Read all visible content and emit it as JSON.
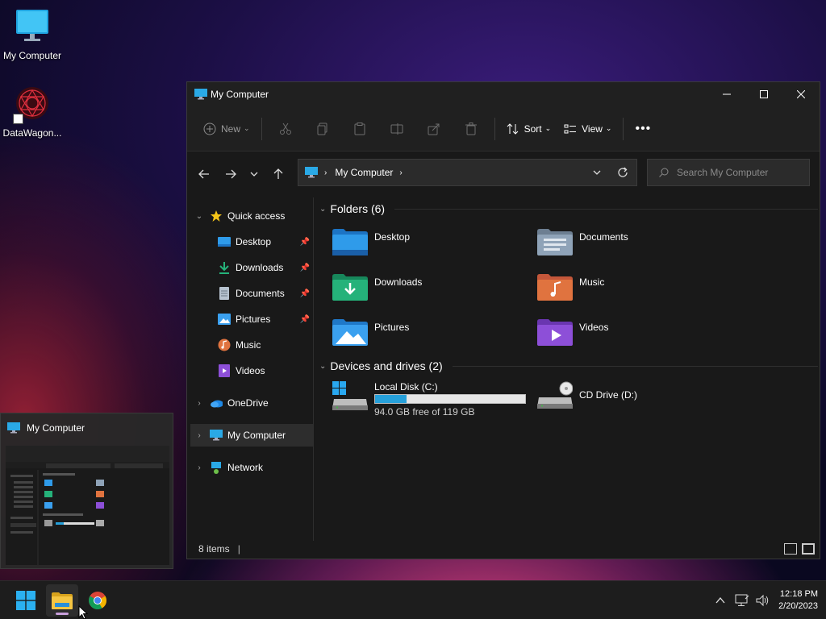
{
  "desktop": {
    "icons": [
      {
        "label": "My Computer",
        "icon": "monitor-icon"
      },
      {
        "label": "DataWagon...",
        "icon": "datawagon-logo-icon"
      }
    ]
  },
  "window": {
    "title": "My Computer",
    "controls": {
      "minimize": "minimize-icon",
      "maximize": "maximize-icon",
      "close": "close-icon"
    },
    "toolbar": {
      "new_label": "New",
      "sort_label": "Sort",
      "view_label": "View",
      "icons": [
        "cut-icon",
        "copy-icon",
        "paste-icon",
        "rename-icon",
        "share-icon",
        "delete-icon",
        "more-icon"
      ]
    },
    "address": {
      "segments": [
        "My Computer"
      ],
      "search_placeholder": "Search My Computer"
    },
    "nav": {
      "quick_access": "Quick access",
      "items": [
        {
          "label": "Desktop",
          "pinned": true
        },
        {
          "label": "Downloads",
          "pinned": true
        },
        {
          "label": "Documents",
          "pinned": true
        },
        {
          "label": "Pictures",
          "pinned": true
        },
        {
          "label": "Music",
          "pinned": false
        },
        {
          "label": "Videos",
          "pinned": false
        }
      ],
      "onedrive": "OneDrive",
      "my_computer": "My Computer",
      "network": "Network"
    },
    "content": {
      "folders_header": "Folders (6)",
      "folders": [
        {
          "label": "Desktop",
          "color": "#2f9bea"
        },
        {
          "label": "Documents",
          "color": "#8fa3b8"
        },
        {
          "label": "Downloads",
          "color": "#25b27a"
        },
        {
          "label": "Music",
          "color": "#e0733f"
        },
        {
          "label": "Pictures",
          "color": "#3aa0ef"
        },
        {
          "label": "Videos",
          "color": "#8d4fd8"
        }
      ],
      "drives_header": "Devices and drives (2)",
      "drives": [
        {
          "label": "Local Disk (C:)",
          "free_text": "94.0 GB free of 119 GB",
          "used_fraction": 0.21
        },
        {
          "label": "CD Drive (D:)"
        }
      ]
    },
    "status": {
      "items_text": "8 items"
    }
  },
  "thumbnail": {
    "title": "My Computer"
  },
  "taskbar": {
    "apps": [
      "start-icon",
      "file-explorer-icon",
      "chrome-icon"
    ],
    "time": "12:18 PM",
    "date": "2/20/2023"
  }
}
